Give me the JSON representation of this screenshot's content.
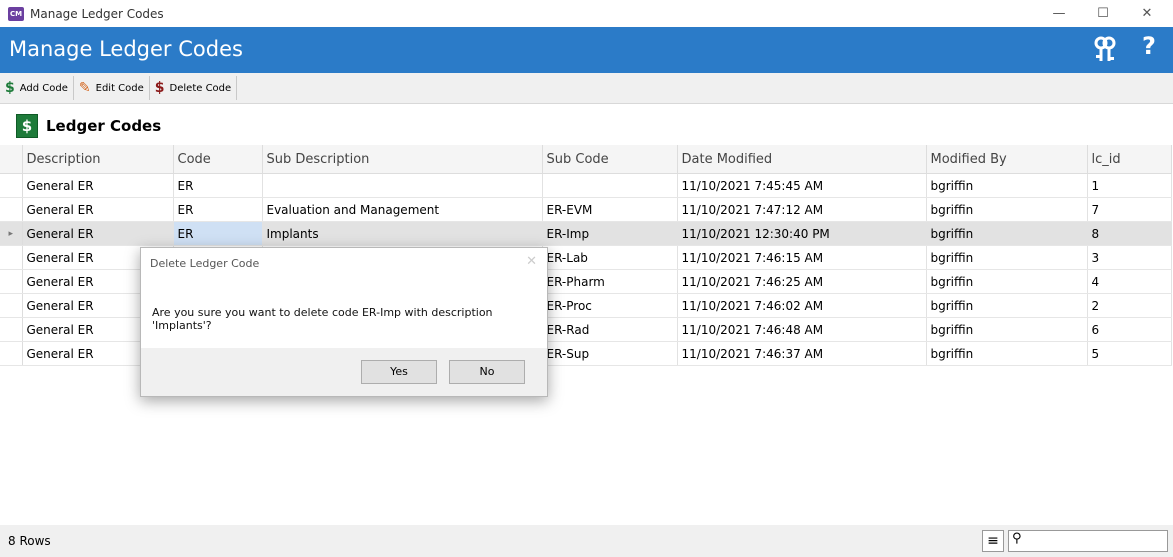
{
  "window": {
    "title": "Manage Ledger Codes",
    "app_icon": "CM",
    "minimize": "—",
    "maximize": "☐",
    "close": "✕"
  },
  "header": {
    "title": "Manage Ledger Codes",
    "help": "?",
    "keys_icon": "keys-icon",
    "accent_color": "#2b7bc8"
  },
  "toolbar": {
    "add_label": "Add Code",
    "edit_label": "Edit Code",
    "delete_label": "Delete Code"
  },
  "section": {
    "icon": "$",
    "title": "Ledger Codes"
  },
  "grid": {
    "columns": [
      "Description",
      "Code",
      "Sub Description",
      "Sub Code",
      "Date Modified",
      "Modified By",
      "lc_id"
    ],
    "rows": [
      [
        "General ER",
        "ER",
        "",
        "",
        "11/10/2021 7:45:45 AM",
        "bgriffin",
        "1"
      ],
      [
        "General ER",
        "ER",
        "Evaluation and Management",
        "ER-EVM",
        "11/10/2021 7:47:12 AM",
        "bgriffin",
        "7"
      ],
      [
        "General ER",
        "ER",
        "Implants",
        "ER-Imp",
        "11/10/2021 12:30:40 PM",
        "bgriffin",
        "8"
      ],
      [
        "General ER",
        "",
        "",
        "ER-Lab",
        "11/10/2021 7:46:15 AM",
        "bgriffin",
        "3"
      ],
      [
        "General ER",
        "",
        "",
        "ER-Pharm",
        "11/10/2021 7:46:25 AM",
        "bgriffin",
        "4"
      ],
      [
        "General ER",
        "",
        "",
        "ER-Proc",
        "11/10/2021 7:46:02 AM",
        "bgriffin",
        "2"
      ],
      [
        "General ER",
        "",
        "",
        "ER-Rad",
        "11/10/2021 7:46:48 AM",
        "bgriffin",
        "6"
      ],
      [
        "General ER",
        "",
        "",
        "ER-Sup",
        "11/10/2021 7:46:37 AM",
        "bgriffin",
        "5"
      ]
    ],
    "selected_row_index": 2,
    "row_indicator": "▸"
  },
  "status": {
    "rows_label": "8 Rows",
    "menu_icon": "≡",
    "search_icon": "⚲",
    "search_value": ""
  },
  "dialog": {
    "title": "Delete Ledger Code",
    "close": "✕",
    "message": "Are you sure you want to delete code ER-Imp with description 'Implants'?",
    "yes_label": "Yes",
    "no_label": "No"
  }
}
